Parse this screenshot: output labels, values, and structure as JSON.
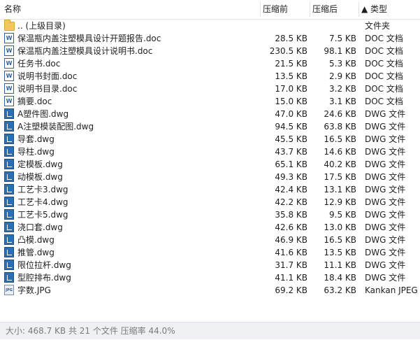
{
  "header": {
    "name": "名称",
    "size": "压缩前",
    "compressed": "压缩后",
    "type": "▲ 类型"
  },
  "files": [
    {
      "name": ".. (上级目录)",
      "size": "",
      "compressed": "",
      "type": "文件夹",
      "icon": "folder-icon"
    },
    {
      "name": "保温瓶内盖注塑模具设计开题报告.doc",
      "size": "28.5 KB",
      "compressed": "7.5 KB",
      "type": "DOC 文档",
      "icon": "doc-icon"
    },
    {
      "name": "保温瓶内盖注塑模具设计说明书.doc",
      "size": "230.5 KB",
      "compressed": "98.1 KB",
      "type": "DOC 文档",
      "icon": "doc-icon"
    },
    {
      "name": "任务书.doc",
      "size": "21.5 KB",
      "compressed": "5.3 KB",
      "type": "DOC 文档",
      "icon": "doc-icon"
    },
    {
      "name": "说明书封面.doc",
      "size": "13.5 KB",
      "compressed": "2.9 KB",
      "type": "DOC 文档",
      "icon": "doc-icon"
    },
    {
      "name": "说明书目录.doc",
      "size": "17.0 KB",
      "compressed": "3.2 KB",
      "type": "DOC 文档",
      "icon": "doc-icon"
    },
    {
      "name": "摘要.doc",
      "size": "15.0 KB",
      "compressed": "3.1 KB",
      "type": "DOC 文档",
      "icon": "doc-icon"
    },
    {
      "name": "A塑件图.dwg",
      "size": "47.0 KB",
      "compressed": "24.6 KB",
      "type": "DWG 文件",
      "icon": "dwg-icon"
    },
    {
      "name": "A注塑模装配图.dwg",
      "size": "94.5 KB",
      "compressed": "63.8 KB",
      "type": "DWG 文件",
      "icon": "dwg-icon"
    },
    {
      "name": "导套.dwg",
      "size": "45.5 KB",
      "compressed": "16.5 KB",
      "type": "DWG 文件",
      "icon": "dwg-icon"
    },
    {
      "name": "导柱.dwg",
      "size": "43.7 KB",
      "compressed": "14.6 KB",
      "type": "DWG 文件",
      "icon": "dwg-icon"
    },
    {
      "name": "定模板.dwg",
      "size": "65.1 KB",
      "compressed": "40.2 KB",
      "type": "DWG 文件",
      "icon": "dwg-icon"
    },
    {
      "name": "动模板.dwg",
      "size": "49.3 KB",
      "compressed": "17.5 KB",
      "type": "DWG 文件",
      "icon": "dwg-icon"
    },
    {
      "name": "工艺卡3.dwg",
      "size": "42.4 KB",
      "compressed": "13.1 KB",
      "type": "DWG 文件",
      "icon": "dwg-icon"
    },
    {
      "name": "工艺卡4.dwg",
      "size": "42.2 KB",
      "compressed": "12.9 KB",
      "type": "DWG 文件",
      "icon": "dwg-icon"
    },
    {
      "name": "工艺卡5.dwg",
      "size": "35.8 KB",
      "compressed": "9.5 KB",
      "type": "DWG 文件",
      "icon": "dwg-icon"
    },
    {
      "name": "浇口套.dwg",
      "size": "42.6 KB",
      "compressed": "13.0 KB",
      "type": "DWG 文件",
      "icon": "dwg-icon"
    },
    {
      "name": "凸模.dwg",
      "size": "46.9 KB",
      "compressed": "16.5 KB",
      "type": "DWG 文件",
      "icon": "dwg-icon"
    },
    {
      "name": "推管.dwg",
      "size": "41.6 KB",
      "compressed": "13.5 KB",
      "type": "DWG 文件",
      "icon": "dwg-icon"
    },
    {
      "name": "限位拉杆.dwg",
      "size": "31.7 KB",
      "compressed": "11.1 KB",
      "type": "DWG 文件",
      "icon": "dwg-icon"
    },
    {
      "name": "型腔排布.dwg",
      "size": "41.1 KB",
      "compressed": "18.4 KB",
      "type": "DWG 文件",
      "icon": "dwg-icon"
    },
    {
      "name": "字数.JPG",
      "size": "69.2 KB",
      "compressed": "63.2 KB",
      "type": "Kankan JPEG",
      "icon": "jpg-icon"
    }
  ],
  "status": {
    "text": "大小: 468.7 KB 共 21 个文件 压缩率 44.0%"
  }
}
